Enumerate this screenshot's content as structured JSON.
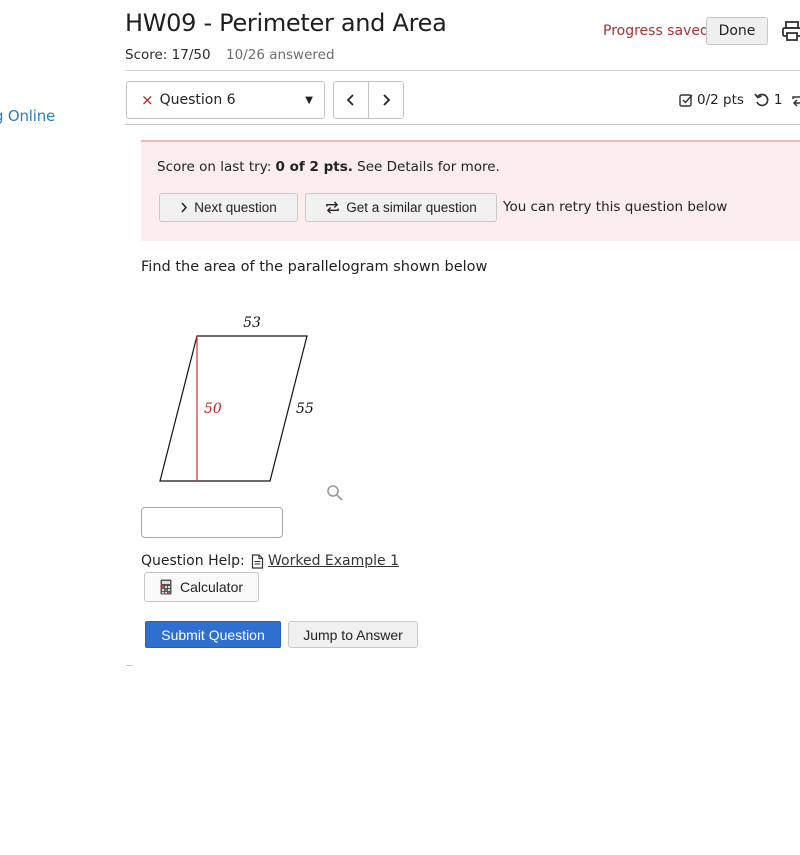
{
  "sidebar": {
    "link_label": "g Online"
  },
  "header": {
    "title": "HW09 - Perimeter and Area",
    "score": "Score: 17/50",
    "answered": "10/26 answered",
    "progress_status": "Progress saved",
    "done_label": "Done",
    "print_icon": "print-icon"
  },
  "question_nav": {
    "selected_question": "Question 6",
    "status_icon": "×",
    "prev_label": "‹",
    "next_label": "›",
    "points": "0/2 pts",
    "retries": "1"
  },
  "banner": {
    "prefix": "Score on last try: ",
    "score_bold": "0 of 2 pts.",
    "suffix": " See Details for more.",
    "next_question_label": "Next question",
    "similar_question_label": "Get a similar question",
    "retry_note": "You can retry this question below"
  },
  "question": {
    "prompt": "Find the area of the parallelogram shown below",
    "figure": {
      "top_label": "53",
      "height_label": "50",
      "side_label": "55",
      "height_color": "#cc2222"
    },
    "answer_value": "",
    "help_label": "Question Help:",
    "worked_example_label": "Worked Example 1",
    "calculator_label": "Calculator"
  },
  "actions": {
    "submit_label": "Submit Question",
    "jump_label": "Jump to Answer"
  },
  "colors": {
    "primary": "#2e6fcf",
    "error": "#b22d2d",
    "banner_bg": "#fdeeee",
    "link": "#2e7fb8"
  }
}
